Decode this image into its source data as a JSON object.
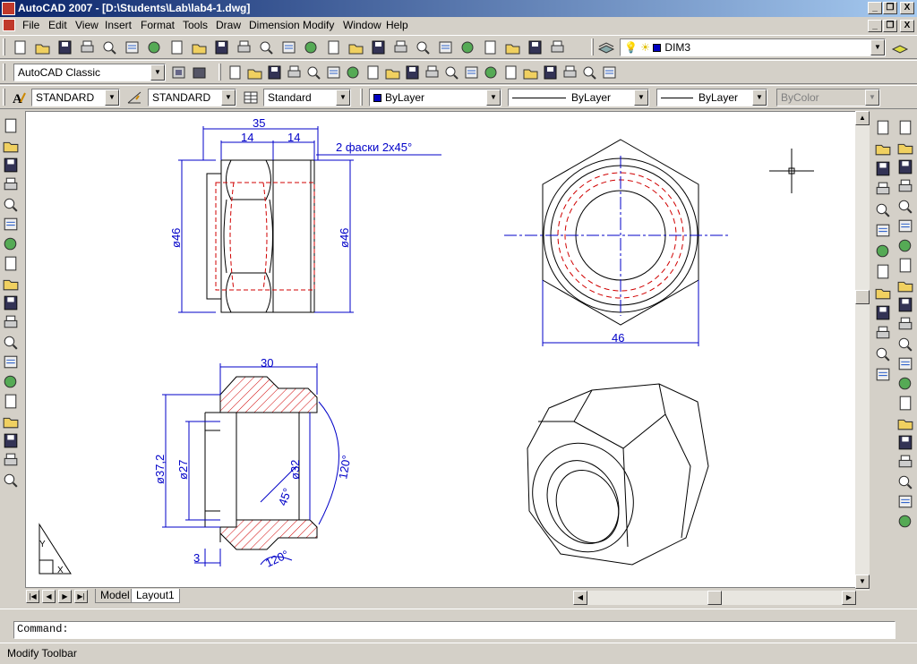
{
  "window": {
    "title": "AutoCAD 2007 - [D:\\Students\\Lab\\lab4-1.dwg]",
    "logo_text": "ACAD",
    "controls": {
      "minimize": "_",
      "restore": "❐",
      "close": "X"
    }
  },
  "menu": {
    "items": [
      "File",
      "Edit",
      "View",
      "Insert",
      "Format",
      "Tools",
      "Draw",
      "Dimension",
      "Modify",
      "Window",
      "Help"
    ]
  },
  "toolbars": {
    "standard_icons": [
      "new-icon",
      "open-icon",
      "save-icon",
      "plot-icon",
      "plot-preview-icon",
      "publish-icon",
      "3d-dwf-icon",
      "cut-icon",
      "copy-icon",
      "paste-icon",
      "match-properties-icon",
      "block-editor-icon",
      "undo-icon",
      "redo-icon",
      "pan-icon",
      "zoom-realtime-icon",
      "zoom-window-icon",
      "zoom-previous-icon",
      "properties-icon",
      "design-center-icon",
      "tool-palettes-icon",
      "sheet-set-icon",
      "markup-icon",
      "quickcalc-icon",
      "help-icon"
    ],
    "layer_combo": "DIM3",
    "workspace": "AutoCAD Classic",
    "text_style": "STANDARD",
    "dim_style": "STANDARD",
    "table_style": "Standard",
    "color": "ByLayer",
    "linetype": "ByLayer",
    "lineweight": "ByLayer",
    "plot_style": "ByColor",
    "accent_colors": {
      "swatch": "#0000c0",
      "title_start": "#0a246a",
      "dimension": "#0000c8",
      "hidden": "#d00000"
    }
  },
  "draw_toolbar": [
    "line-icon",
    "construction-line-icon",
    "polyline-icon",
    "polygon-icon",
    "rectangle-icon",
    "arc-icon",
    "circle-icon",
    "revision-cloud-icon",
    "spline-icon",
    "ellipse-icon",
    "ellipse-arc-icon",
    "insert-block-icon",
    "make-block-icon",
    "point-icon",
    "hatch-icon",
    "gradient-icon",
    "region-icon",
    "table-icon",
    "multiline-text-icon"
  ],
  "tabs": {
    "model": "Model",
    "layout": "Layout1"
  },
  "command": {
    "prompt": "Command:"
  },
  "status": {
    "text": "Modify Toolbar"
  },
  "drawing": {
    "dims": {
      "front_width": "35",
      "front_left": "14",
      "front_right": "14",
      "chamfer_note": "2 фаски 2х45°",
      "front_dia_left": "ø46",
      "front_dia_right": "ø46",
      "side_width": "46",
      "section_width": "30",
      "section_outer_dia": "ø37,2",
      "section_inner_dia": "ø27",
      "section_bore_dia": "ø32",
      "section_angle_bore": "45°",
      "section_angle_right": "120°",
      "section_angle_bottom": "120°",
      "section_small": "3"
    },
    "ucs_axes": {
      "x": "X",
      "y": "Y"
    }
  }
}
